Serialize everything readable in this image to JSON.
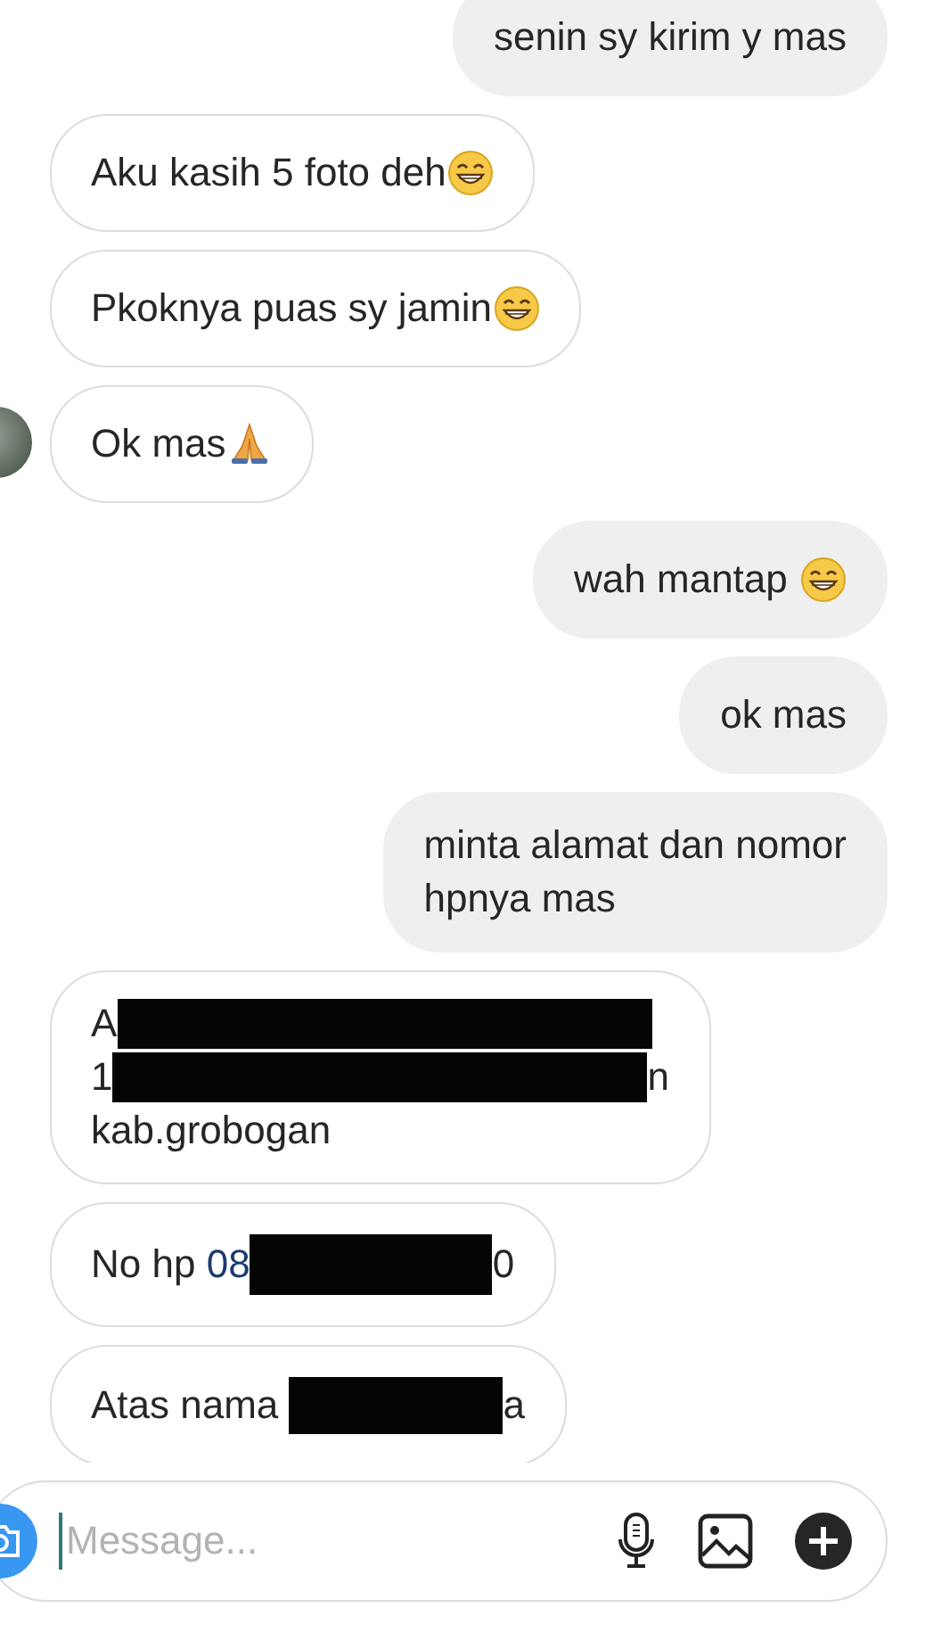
{
  "messages": [
    {
      "outgoing": true,
      "avatar": false,
      "lines": [
        [
          {
            "kind": "text",
            "text": "senin sy kirim y mas"
          }
        ]
      ]
    },
    {
      "outgoing": false,
      "avatar": false,
      "lines": [
        [
          {
            "kind": "text",
            "text": "Aku kasih 5 foto deh"
          },
          {
            "kind": "grin"
          }
        ]
      ]
    },
    {
      "outgoing": false,
      "avatar": false,
      "lines": [
        [
          {
            "kind": "text",
            "text": "Pkoknya puas sy jamin"
          },
          {
            "kind": "grin"
          }
        ]
      ]
    },
    {
      "outgoing": false,
      "avatar": true,
      "lines": [
        [
          {
            "kind": "text",
            "text": "Ok mas"
          },
          {
            "kind": "pray"
          }
        ]
      ]
    },
    {
      "outgoing": true,
      "avatar": false,
      "lines": [
        [
          {
            "kind": "text",
            "text": "wah mantap "
          },
          {
            "kind": "grin"
          }
        ]
      ]
    },
    {
      "outgoing": true,
      "avatar": false,
      "lines": [
        [
          {
            "kind": "text",
            "text": "ok mas"
          }
        ]
      ]
    },
    {
      "outgoing": true,
      "avatar": false,
      "lines": [
        [
          {
            "kind": "text",
            "text": "minta alamat dan nomor"
          }
        ],
        [
          {
            "kind": "text",
            "text": "hpnya mas"
          }
        ]
      ]
    },
    {
      "outgoing": false,
      "avatar": false,
      "lines": [
        [
          {
            "kind": "text",
            "text": "A"
          },
          {
            "kind": "redaction"
          }
        ],
        [
          {
            "kind": "text",
            "text": "1"
          },
          {
            "kind": "redaction"
          },
          {
            "kind": "text",
            "text": "n"
          }
        ],
        [
          {
            "kind": "text",
            "text": "kab.grobogan"
          }
        ]
      ]
    },
    {
      "outgoing": false,
      "avatar": false,
      "lines": [
        [
          {
            "kind": "text",
            "text": "No hp "
          },
          {
            "kind": "link",
            "text": "08"
          },
          {
            "kind": "redaction"
          },
          {
            "kind": "text",
            "text": "0"
          }
        ]
      ]
    },
    {
      "outgoing": false,
      "avatar": false,
      "lines": [
        [
          {
            "kind": "text",
            "text": "Atas nama "
          },
          {
            "kind": "redaction"
          },
          {
            "kind": "text",
            "text": "a"
          }
        ]
      ]
    }
  ],
  "composer": {
    "placeholder": "Message..."
  }
}
